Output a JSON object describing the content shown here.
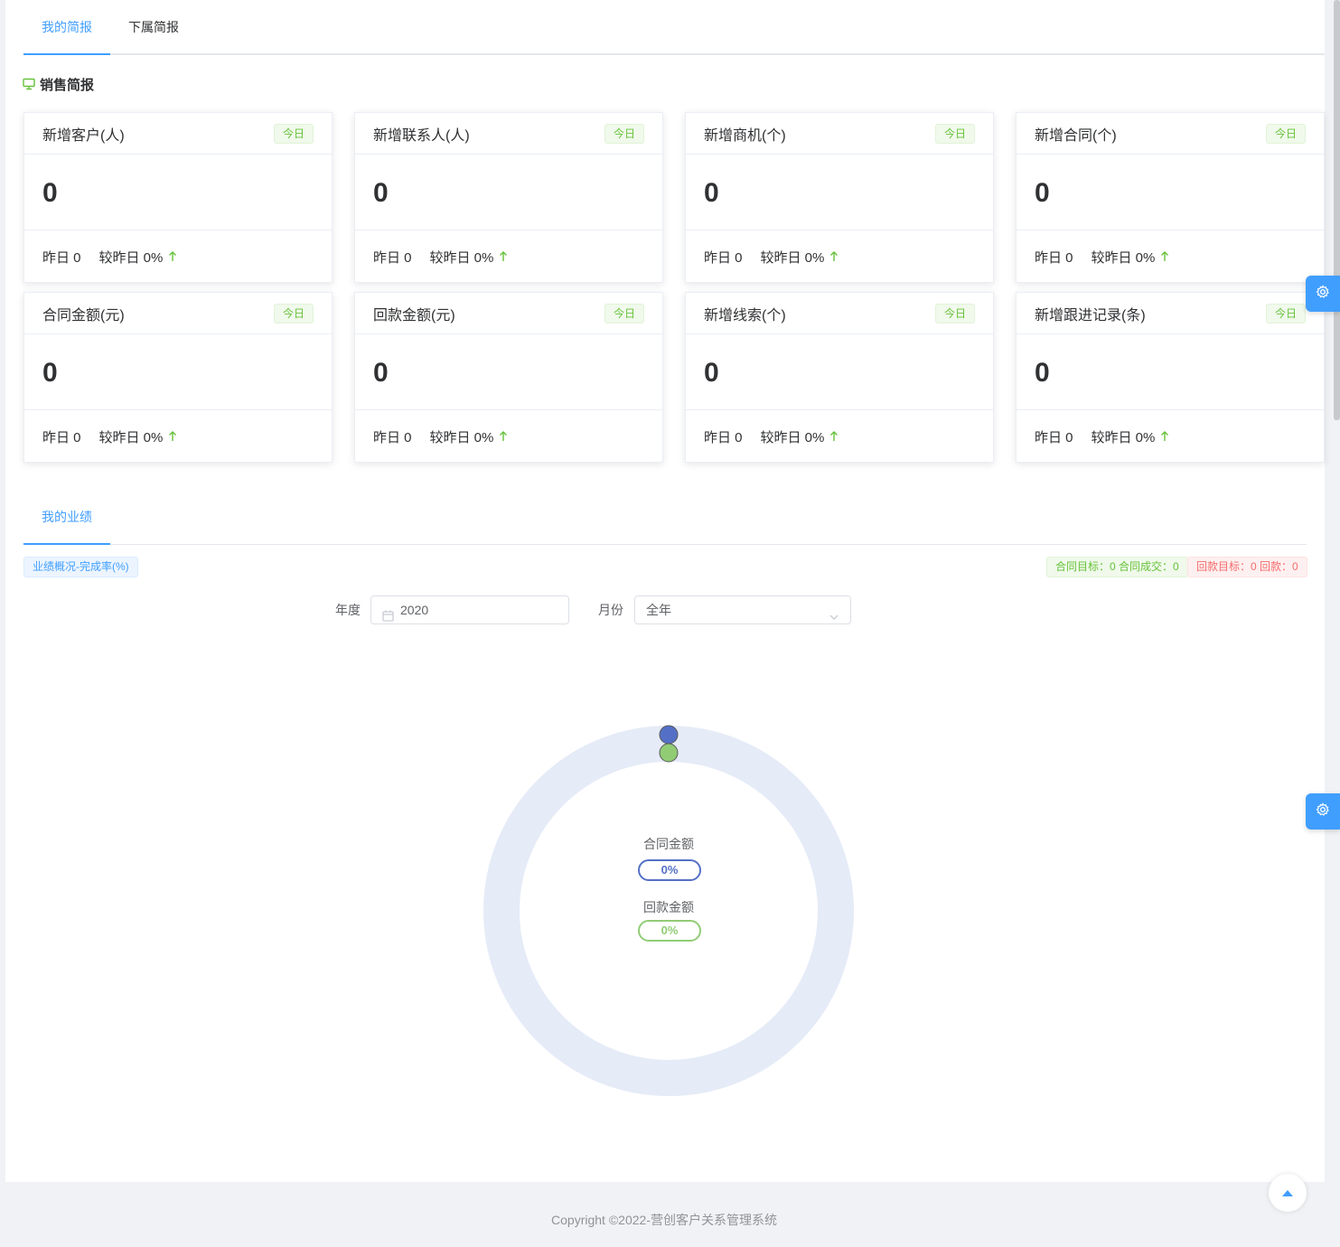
{
  "tabs_top": [
    {
      "label": "我的简报",
      "active": true
    },
    {
      "label": "下属简报",
      "active": false
    }
  ],
  "section_title": "销售简报",
  "cards": [
    {
      "title": "新增客户(人)",
      "tag": "今日",
      "value": "0",
      "yesterday": "昨日 0",
      "compare": "较昨日 0%"
    },
    {
      "title": "新增联系人(人)",
      "tag": "今日",
      "value": "0",
      "yesterday": "昨日 0",
      "compare": "较昨日 0%"
    },
    {
      "title": "新增商机(个)",
      "tag": "今日",
      "value": "0",
      "yesterday": "昨日 0",
      "compare": "较昨日 0%"
    },
    {
      "title": "新增合同(个)",
      "tag": "今日",
      "value": "0",
      "yesterday": "昨日 0",
      "compare": "较昨日 0%"
    },
    {
      "title": "合同金额(元)",
      "tag": "今日",
      "value": "0",
      "yesterday": "昨日 0",
      "compare": "较昨日 0%"
    },
    {
      "title": "回款金额(元)",
      "tag": "今日",
      "value": "0",
      "yesterday": "昨日 0",
      "compare": "较昨日 0%"
    },
    {
      "title": "新增线索(个)",
      "tag": "今日",
      "value": "0",
      "yesterday": "昨日 0",
      "compare": "较昨日 0%"
    },
    {
      "title": "新增跟进记录(条)",
      "tag": "今日",
      "value": "0",
      "yesterday": "昨日 0",
      "compare": "较昨日 0%"
    }
  ],
  "perf_tab": {
    "label": "我的业绩"
  },
  "perf_tag": "业绩概况-完成率(%)",
  "contract_summary": "合同目标：0 合同成交：0",
  "payment_summary": "回款目标：0 回款：0",
  "filters": {
    "year_label": "年度",
    "year_value": "2020",
    "month_label": "月份",
    "month_value": "全年"
  },
  "chart": {
    "contract_label": "合同金额",
    "contract_pct": "0%",
    "payment_label": "回款金额",
    "payment_pct": "0%"
  },
  "chart_data": {
    "type": "pie",
    "series": [
      {
        "name": "合同金额",
        "value": 0,
        "unit": "%"
      },
      {
        "name": "回款金额",
        "value": 0,
        "unit": "%"
      }
    ],
    "colors": {
      "track": "#e5ebf7",
      "contract": "#5470c6",
      "payment": "#91cc75"
    }
  },
  "colors": {
    "accent": "#409eff",
    "success": "#67c23a",
    "danger": "#f56c6c"
  },
  "footer": "Copyright ©2022-营创客户关系管理系统"
}
